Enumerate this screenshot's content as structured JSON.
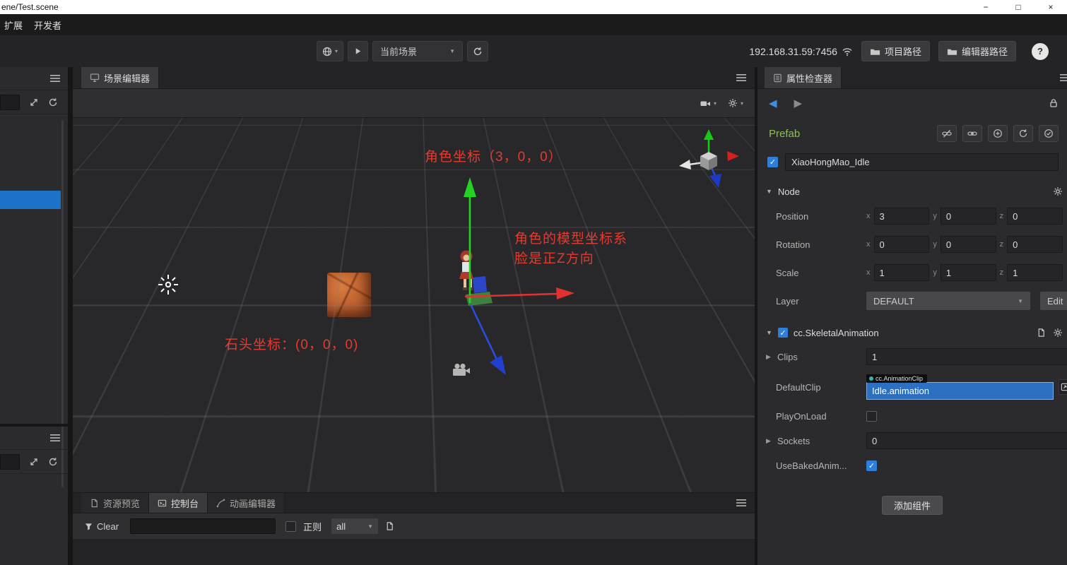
{
  "window": {
    "title": "ene/Test.scene",
    "minimize": "−",
    "maximize": "□",
    "close": "×"
  },
  "menubar": {
    "items": [
      {
        "label": "扩展"
      },
      {
        "label": "开发者"
      }
    ]
  },
  "toolbar": {
    "scene_dropdown": "当前场景",
    "address": "192.168.31.59:7456",
    "project_path_label": "项目路径",
    "editor_path_label": "编辑器路径",
    "help_label": "?"
  },
  "scene_panel": {
    "tab_label": "场景编辑器",
    "annotations": {
      "char_coord": "角色坐标（3，0，0）",
      "model_axis_line1": "角色的模型坐标系",
      "model_axis_line2": "脸是正Z方向",
      "stone_coord": "石头坐标：(0，0，0)"
    }
  },
  "bottom_panel": {
    "tabs": [
      {
        "label": "资源预览"
      },
      {
        "label": "控制台"
      },
      {
        "label": "动画编辑器"
      }
    ],
    "console": {
      "clear_label": "Clear",
      "regex_label": "正则",
      "filter_value": "all"
    }
  },
  "inspector": {
    "tab_label": "属性检查器",
    "prefab_label": "Prefab",
    "node_name": "XiaoHongMao_Idle",
    "node_section": "Node",
    "axis": {
      "x": "x",
      "y": "y",
      "z": "z"
    },
    "position": {
      "label": "Position",
      "x": "3",
      "y": "0",
      "z": "0"
    },
    "rotation": {
      "label": "Rotation",
      "x": "0",
      "y": "0",
      "z": "0"
    },
    "scale": {
      "label": "Scale",
      "x": "1",
      "y": "1",
      "z": "1"
    },
    "layer": {
      "label": "Layer",
      "value": "DEFAULT",
      "edit_label": "Edit"
    },
    "skeletal": {
      "title": "cc.SkeletalAnimation",
      "clips_label": "Clips",
      "clips_value": "1",
      "default_clip_label": "DefaultClip",
      "clip_type": "cc.AnimationClip",
      "clip_value": "Idle.animation",
      "play_on_load_label": "PlayOnLoad",
      "sockets_label": "Sockets",
      "sockets_value": "0",
      "use_baked_label": "UseBakedAnim..."
    },
    "add_component_label": "添加组件"
  },
  "colors": {
    "accent_blue": "#1b72c8",
    "prefab_green": "#8bc34a",
    "annotation_red": "#e8392e"
  }
}
